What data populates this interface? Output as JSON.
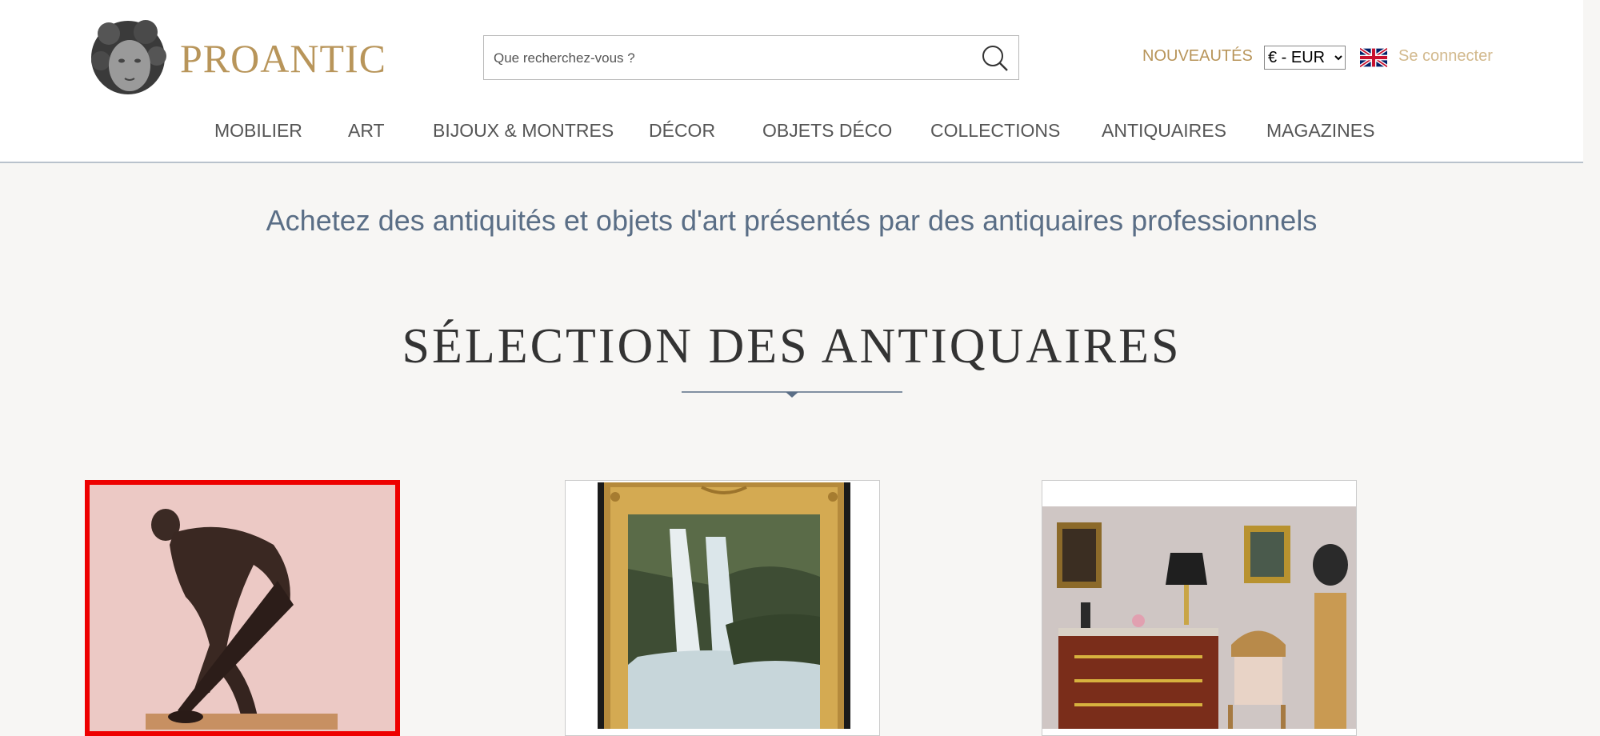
{
  "header": {
    "logo_text": "PROANTIC",
    "search": {
      "placeholder": "Que recherchez-vous ?"
    },
    "nouveautes": "NOUVEAUTÉS",
    "currency": {
      "selected": "€ - EUR",
      "options": [
        "€ - EUR"
      ]
    },
    "language_flag": "uk-flag-icon",
    "login": "Se connecter",
    "accent_color": "#b8955a"
  },
  "nav": {
    "items": [
      "MOBILIER",
      "ART",
      "BIJOUX & MONTRES",
      "DÉCOR",
      "OBJETS DÉCO",
      "COLLECTIONS",
      "ANTIQUAIRES",
      "MAGAZINES"
    ]
  },
  "main": {
    "tagline": "Achetez des antiquités et objets d'art présentés par des antiquaires professionnels",
    "section_title": "SÉLECTION DES ANTIQUAIRES"
  },
  "cards": [
    {
      "image": "bronze-sculpture-image",
      "selected": true
    },
    {
      "image": "waterfall-painting-image",
      "selected": false
    },
    {
      "image": "antique-interior-image",
      "selected": false
    }
  ]
}
